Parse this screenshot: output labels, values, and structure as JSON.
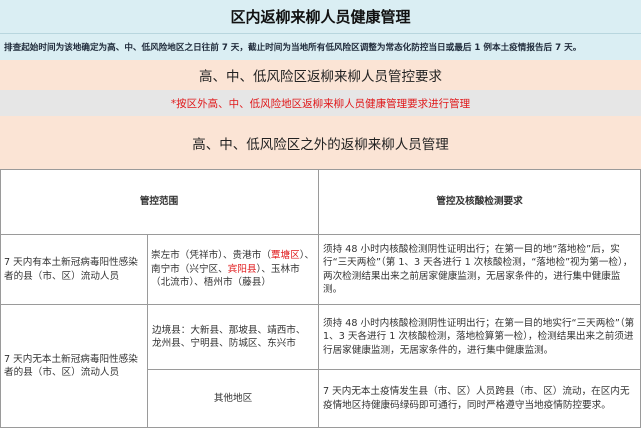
{
  "header": {
    "title": "区内返柳来柳人员健康管理",
    "note": "排查起始时间为该地确定为高、中、低风险地区之日往前 7 天，截止时间为当地所有低风险区调整为常态化防控当日或最后 1 例本土疫情报告后 7 天。"
  },
  "section_risk": {
    "heading": "高、中、低风险区返柳来柳人员管控要求",
    "red_note": "*按区外高、中、低风险地区返柳来柳人员健康管理要求进行管理"
  },
  "section_other": {
    "heading": "高、中、低风险区之外的返柳来柳人员管理"
  },
  "table": {
    "col_scope": "管控范围",
    "col_requirement": "管控及核酸检测要求",
    "rows": [
      {
        "group": "7 天内有本土新冠病毒阳性感染者的县（市、区）流动人员",
        "areas_parts": [
          {
            "text": "崇左市（凭祥市）、贵港市（",
            "red": false
          },
          {
            "text": "覃塘区",
            "red": true
          },
          {
            "text": "）、南宁市（兴宁区、",
            "red": false
          },
          {
            "text": "宾阳县",
            "red": true
          },
          {
            "text": "）、玉林市（北流市）、梧州市（藤县）",
            "red": false
          }
        ],
        "requirement": "须持 48 小时内核酸检测阴性证明出行；在第一目的地“落地检”后，实行“三天两检”（第 1、3 天各进行 1 次核酸检测，“落地检”视为第一检），两次检测结果出来之前居家健康监测，无居家条件的，进行集中健康监测。"
      },
      {
        "group": "7 天内无本土新冠病毒阳性感染者的县（市、区）流动人员",
        "areas": "边境县：大新县、那坡县、靖西市、龙州县、宁明县、防城区、东兴市",
        "requirement": "须持 48 小时内核酸检测阴性证明出行；在第一目的地实行“三天两检”（第 1、3 天各进行 1 次核酸检测，落地检算第一检），检测结果出来之前须进行居家健康监测，无居家条件的，进行集中健康监测。"
      },
      {
        "areas": "其他地区",
        "requirement": "7 天内无本土疫情发生县（市、区）人员跨县（市、区）流动，在区内无疫情地区持健康码绿码即可通行，同时严格遵守当地疫情防控要求。"
      }
    ]
  }
}
